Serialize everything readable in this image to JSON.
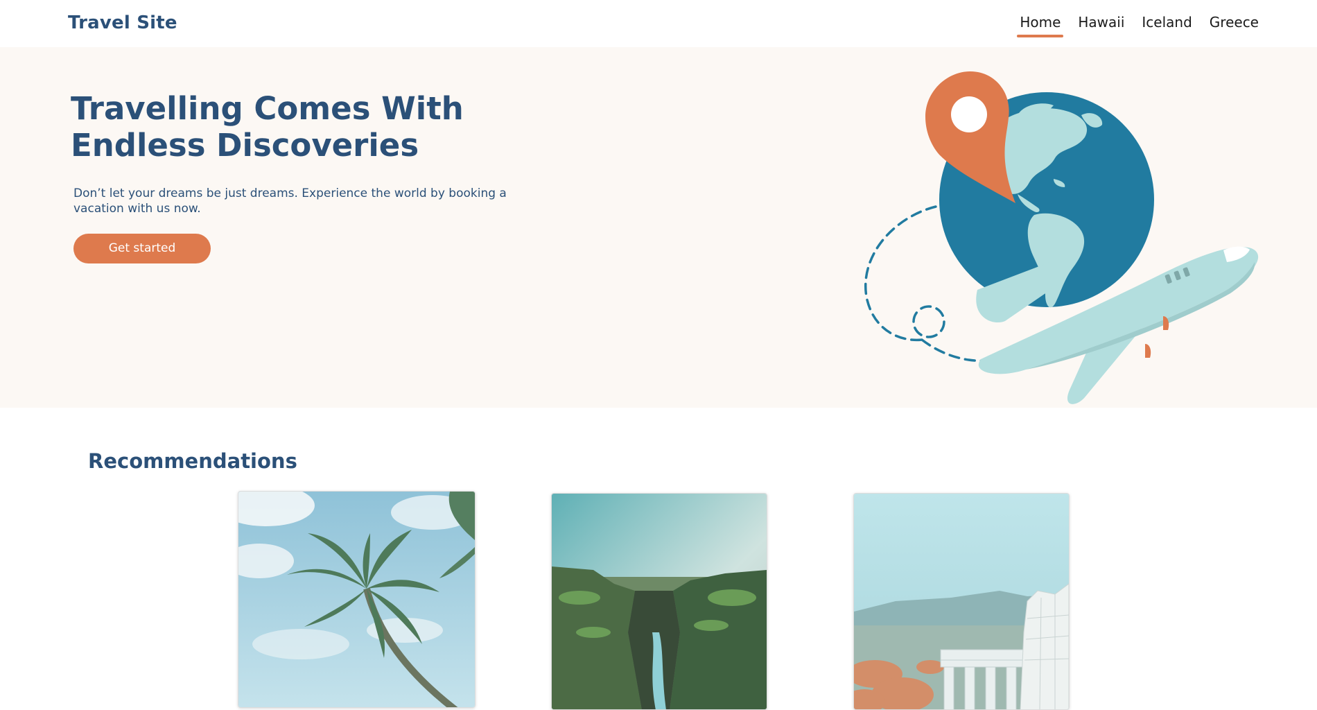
{
  "header": {
    "brand": "Travel Site",
    "nav": [
      {
        "label": "Home",
        "active": true
      },
      {
        "label": "Hawaii",
        "active": false
      },
      {
        "label": "Iceland",
        "active": false
      },
      {
        "label": "Greece",
        "active": false
      }
    ]
  },
  "hero": {
    "title": "Travelling Comes With Endless Discoveries",
    "text": "Don’t let your dreams be just dreams. Experience the world by booking a vacation with us now.",
    "cta_label": "Get started",
    "illustration_icons": [
      "map-pin-icon",
      "globe-icon",
      "airplane-icon",
      "dashed-flight-path"
    ]
  },
  "recommendations": {
    "title": "Recommendations",
    "cards": [
      {
        "image": "palm-tree-photo"
      },
      {
        "image": "iceland-canyon-photo"
      },
      {
        "image": "greece-ruins-photo"
      }
    ]
  },
  "colors": {
    "primary_text": "#2b5078",
    "accent": "#de7a4d",
    "hero_background": "#fcf8f4",
    "globe_ocean": "#217ba0",
    "land": "#b3dede"
  }
}
